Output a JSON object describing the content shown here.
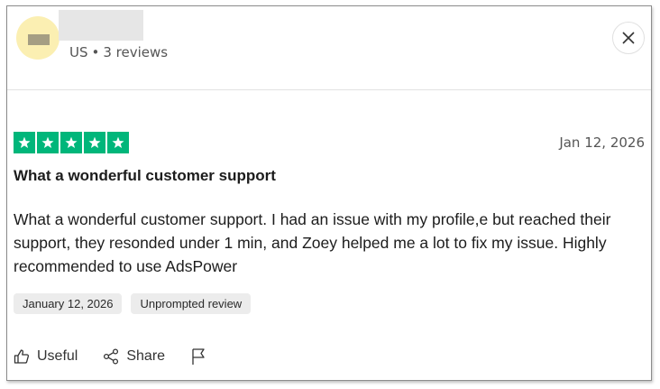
{
  "reviewer": {
    "meta": "US",
    "reviews_count": "3 reviews",
    "separator": "•"
  },
  "review": {
    "rating": 5,
    "rating_max": 5,
    "date_short": "Jan 12, 2026",
    "title": "What a wonderful customer support",
    "body": "What a wonderful customer support. I had an issue with my profile,e but reached their support, they resonded under 1 min, and Zoey helped me a lot to fix my issue. Highly recommended to use AdsPower",
    "tags": [
      "January 12, 2026",
      "Unprompted review"
    ]
  },
  "actions": {
    "useful": "Useful",
    "share": "Share"
  },
  "colors": {
    "star_green": "#00b67a",
    "avatar_bg": "#fbefb2"
  },
  "icons": [
    "close-icon",
    "star-icon",
    "thumbs-up-icon",
    "share-icon",
    "flag-icon"
  ]
}
